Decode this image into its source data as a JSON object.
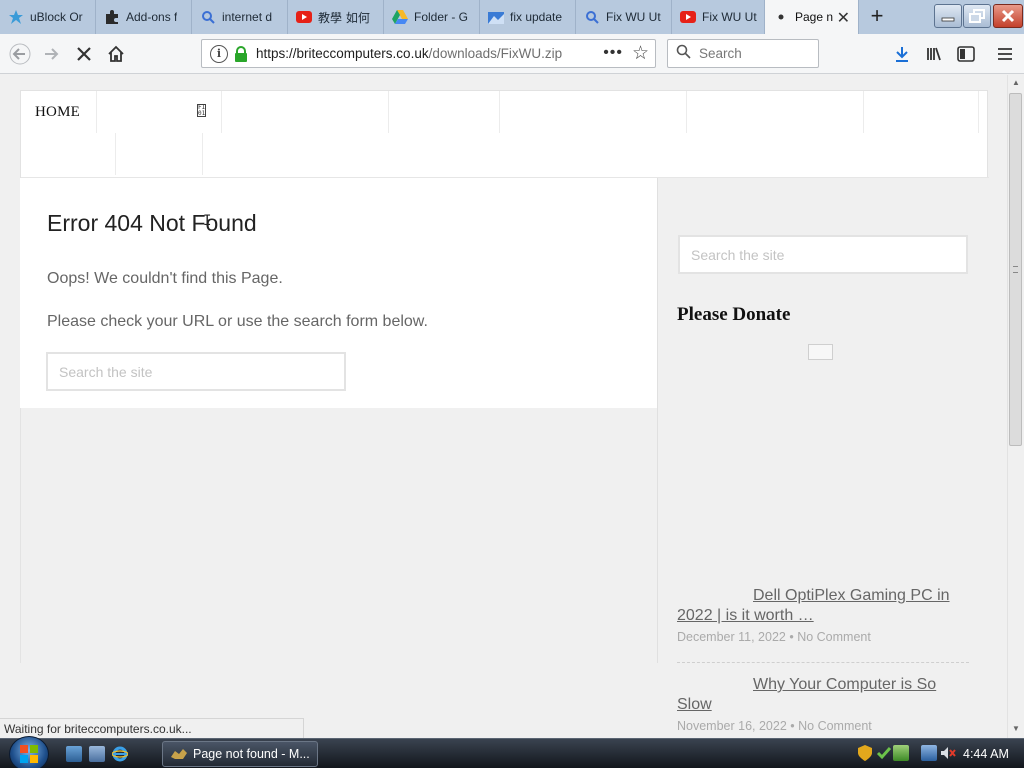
{
  "browser": {
    "tabs": [
      {
        "label": "uBlock Or",
        "icon": "ublock-icon",
        "icon_color": "#3a9bd8"
      },
      {
        "label": "Add-ons f",
        "icon": "puzzle-icon",
        "icon_color": "#2b2b2b"
      },
      {
        "label": "internet d",
        "icon": "search-icon",
        "icon_color": "#3b6fd4"
      },
      {
        "label": "教學 如何",
        "icon": "youtube-icon",
        "icon_color": "#e62117"
      },
      {
        "label": "Folder - G",
        "icon": "drive-icon",
        "icon_color": "#1fa463"
      },
      {
        "label": "fix update",
        "icon": "site-icon",
        "icon_color": "#3a7bd5"
      },
      {
        "label": "Fix WU Ut",
        "icon": "search-icon",
        "icon_color": "#3b6fd4"
      },
      {
        "label": "Fix WU Ut",
        "icon": "youtube-icon",
        "icon_color": "#e62117"
      },
      {
        "label": "Page n",
        "icon": "dot-icon",
        "icon_color": "#333333",
        "active": true
      }
    ],
    "address": {
      "url_host": "https://briteccomputers.co.uk",
      "url_path": "/downloads/FixWU.zip"
    },
    "search_placeholder": "Search",
    "status": "Waiting for briteccomputers.co.uk..."
  },
  "site": {
    "menu_home": "HOME",
    "menu_glyph": "FI 01",
    "error_title": "Error 404 Not Found",
    "error_line1": "Oops! We couldn't find this Page.",
    "error_line2": "Please check your URL or use the search form below.",
    "search_placeholder": "Search the site",
    "sidebar": {
      "donate_title": "Please Donate",
      "posts": [
        {
          "title": "Dell OptiPlex Gaming PC in 2022 | is it worth …",
          "date": "December 11, 2022",
          "comments": "No Comment"
        },
        {
          "title": "Why Your Computer is So Slow",
          "date": "November 16, 2022",
          "comments": "No Comment"
        }
      ]
    }
  },
  "taskbar": {
    "window_label": "Page not found - M...",
    "clock": "4:44 AM"
  },
  "colors": {
    "tabbar_bg": "#b7c9de",
    "lock_green": "#2aa62a",
    "download_blue": "#1a6fd6"
  }
}
